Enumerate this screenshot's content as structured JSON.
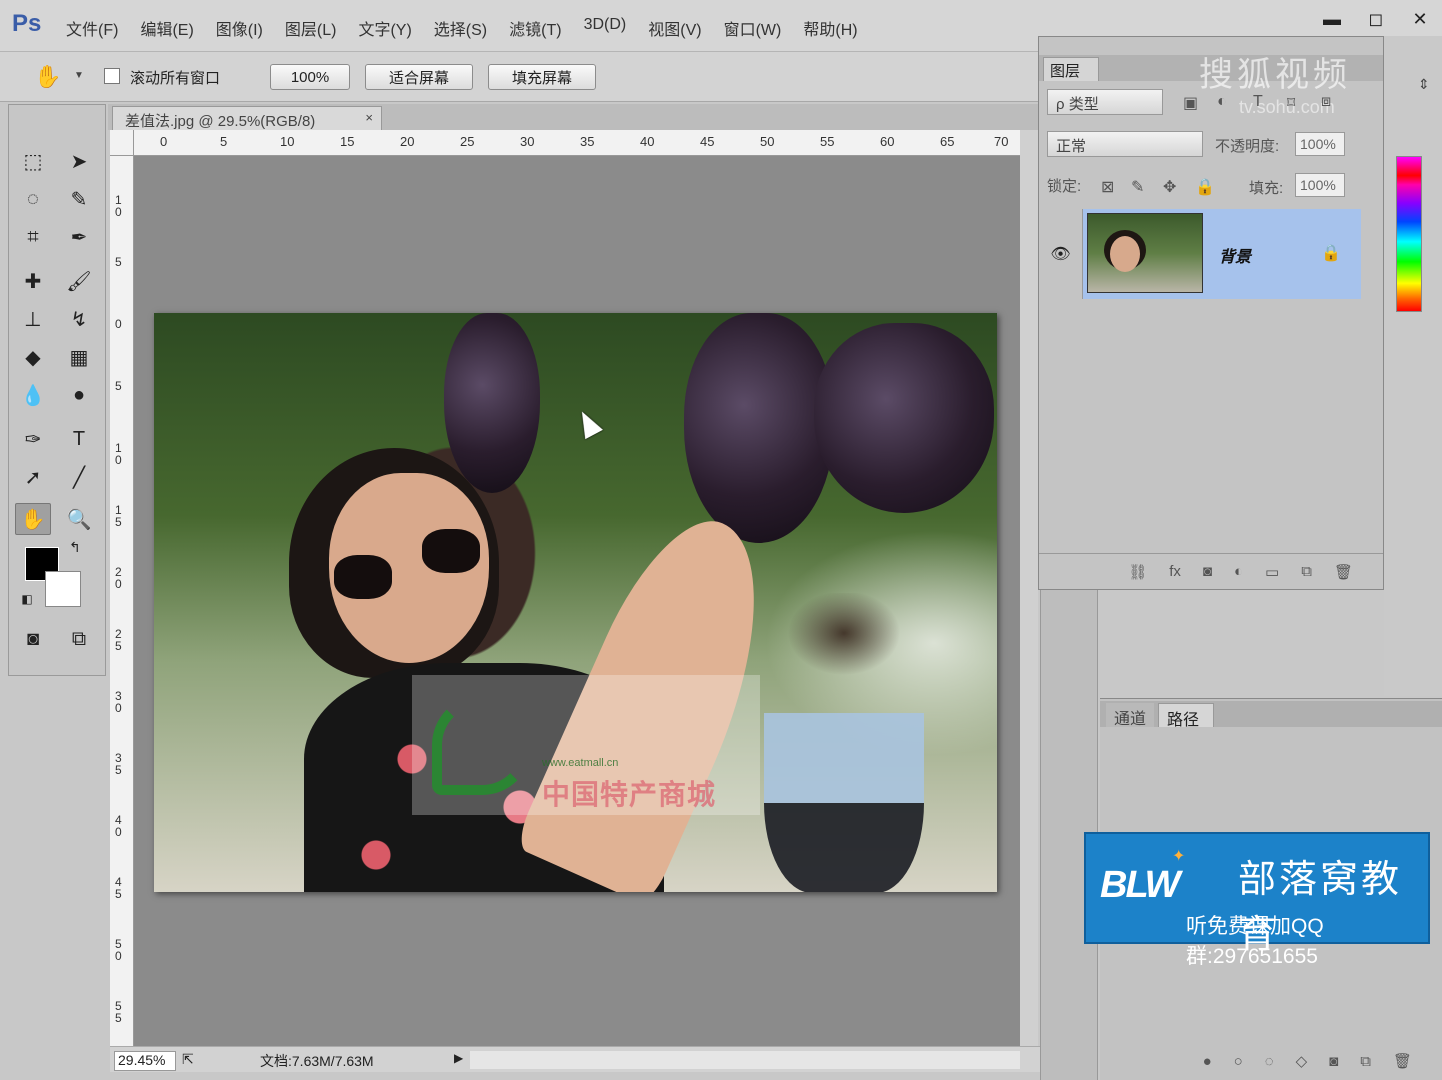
{
  "app": {
    "logo": "Ps",
    "menu": [
      "文件(F)",
      "编辑(E)",
      "图像(I)",
      "图层(L)",
      "文字(Y)",
      "选择(S)",
      "滤镜(T)",
      "3D(D)",
      "视图(V)",
      "窗口(W)",
      "帮助(H)"
    ],
    "window_controls": {
      "minimize": "▬",
      "maximize": "◻",
      "close": "✕"
    }
  },
  "options_bar": {
    "scroll_all_label": "滚动所有窗口",
    "zoom_100": "100%",
    "fit_screen": "适合屏幕",
    "fill_screen": "填充屏幕"
  },
  "document": {
    "tab_title": "差值法.jpg @ 29.5%(RGB/8)",
    "tab_close": "×",
    "ruler_top": [
      "0",
      "5",
      "10",
      "15",
      "20",
      "25",
      "30",
      "35",
      "40",
      "45",
      "50",
      "55",
      "60",
      "65",
      "70"
    ],
    "ruler_left": [
      "10",
      "5",
      "0",
      "5",
      "10",
      "15",
      "20",
      "25",
      "30",
      "35",
      "40",
      "45",
      "50",
      "55"
    ],
    "watermark_url": "www.eatmall.cn",
    "watermark_text": "中国特产商城"
  },
  "status": {
    "zoom": "29.45%",
    "doc_info": "文档:7.63M/7.63M",
    "arrow": "▶"
  },
  "layers_panel": {
    "tab": "图层",
    "filter_type": "ρ 类型",
    "blend_mode": "正常",
    "opacity_label": "不透明度:",
    "opacity_value": "100%",
    "lock_label": "锁定:",
    "fill_label": "填充:",
    "fill_value": "100%",
    "layer_name": "背景",
    "watermark_sohu": "搜狐视频",
    "watermark_sohu_url": "tv.sohu.com"
  },
  "channels_panel": {
    "tab_channels": "通道",
    "tab_paths": "路径"
  },
  "ad": {
    "logo": "BLW",
    "name": "部落窝教育",
    "qq_line": "听免费课加QQ群:297651655"
  },
  "colors": {
    "foreground": "#000000",
    "background": "#ffffff",
    "layer_selected": "#a6c2ec",
    "ad_blue": "#1c82c9"
  }
}
